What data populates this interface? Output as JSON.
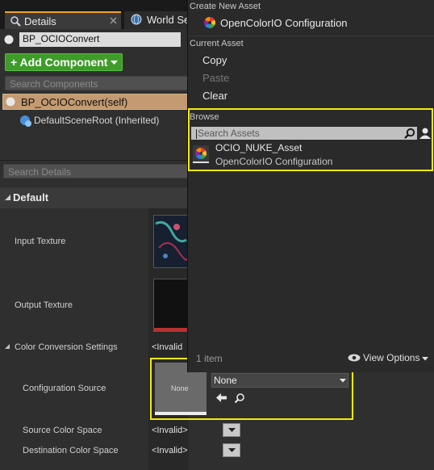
{
  "tabs": {
    "details": "Details",
    "world_settings": "World Se"
  },
  "blueprint_name": "BP_OCIOConvert",
  "add_component": "+ Add Component",
  "search_components_placeholder": "Search Components",
  "components": {
    "self": "BP_OCIOConvert(self)",
    "default_scene_root": "DefaultSceneRoot (Inherited)"
  },
  "search_details_placeholder": "Search Details",
  "section": {
    "title": "Default"
  },
  "properties": {
    "input_texture": "Input Texture",
    "output_texture": "Output Texture",
    "color_conversion_settings": "Color Conversion Settings",
    "configuration_source": "Configuration Source",
    "source_color_space": "Source Color Space",
    "destination_color_space": "Destination Color Space",
    "invalid_value": "<Invalid>",
    "invalid_truncated": "<Invalid",
    "none_thumb": "None",
    "none_dropdown": "None"
  },
  "popup": {
    "create_new_asset_header": "Create New Asset",
    "ocio_configuration": "OpenColorIO Configuration",
    "current_asset_header": "Current Asset",
    "copy": "Copy",
    "paste": "Paste",
    "clear": "Clear",
    "browse_header": "Browse",
    "search_assets_placeholder": "Search Assets",
    "asset_name": "OCIO_NUKE_Asset",
    "asset_type": "OpenColorIO Configuration",
    "item_count": "1 item",
    "view_options": "View Options"
  },
  "colors": {
    "accent_tab": "#f4a21a",
    "add_button": "#3f9b2a",
    "selection": "#c39a71",
    "highlight": "#f6e90c"
  },
  "icons": [
    "details-icon",
    "globe-icon",
    "close-icon",
    "scene-root-icon",
    "expand-arrow-icon",
    "ocio-color-wheel-icon",
    "search-icon",
    "user-icon",
    "eye-icon",
    "chevron-down-icon",
    "back-arrow-icon"
  ]
}
